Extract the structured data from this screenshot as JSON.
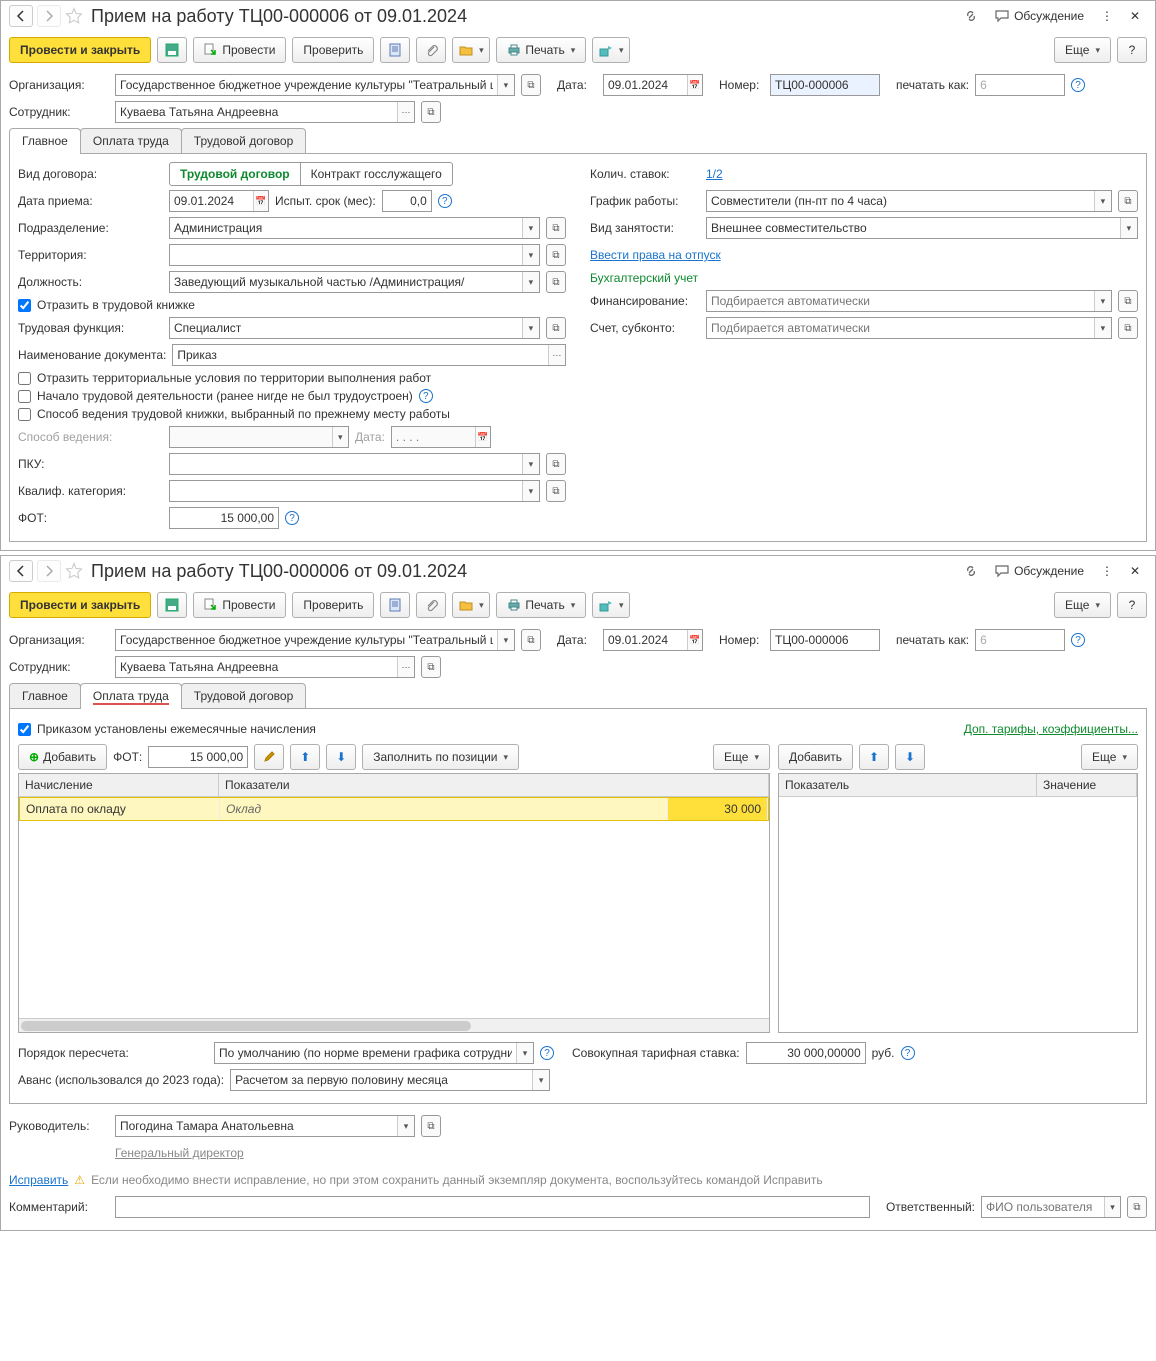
{
  "win1": {
    "title": "Прием на работу ТЦ00-000006 от 09.01.2024",
    "discuss": "Обсуждение",
    "toolbar": {
      "post_close": "Провести и закрыть",
      "post": "Провести",
      "check": "Проверить",
      "print": "Печать",
      "more": "Еще"
    },
    "org_lbl": "Организация:",
    "org_val": "Государственное бюджетное учреждение культуры \"Театральный центр\"",
    "date_lbl": "Дата:",
    "date_val": "09.01.2024",
    "num_lbl": "Номер:",
    "num_val": "ТЦ00-000006",
    "printas_lbl": "печатать как:",
    "printas_val": "6",
    "emp_lbl": "Сотрудник:",
    "emp_val": "Куваева Татьяна Андреевна",
    "tabs": [
      "Главное",
      "Оплата труда",
      "Трудовой договор"
    ],
    "main": {
      "contract_type_lbl": "Вид договора:",
      "seg_a": "Трудовой договор",
      "seg_b": "Контракт госслужащего",
      "hire_date_lbl": "Дата приема:",
      "hire_date_val": "09.01.2024",
      "probation_lbl": "Испыт. срок (мес):",
      "probation_val": "0,0",
      "dept_lbl": "Подразделение:",
      "dept_val": "Администрация",
      "territory_lbl": "Территория:",
      "territory_val": "",
      "position_lbl": "Должность:",
      "position_val": "Заведующий музыкальной частью /Администрация/",
      "reflect_lbl": "Отразить в трудовой книжке",
      "func_lbl": "Трудовая функция:",
      "func_val": "Специалист",
      "docname_lbl": "Наименование документа:",
      "docname_val": "Приказ",
      "chk2": "Отразить территориальные условия по территории выполнения работ",
      "chk3": "Начало трудовой деятельности (ранее нигде не был трудоустроен)",
      "chk4": "Способ ведения трудовой книжки, выбранный по прежнему месту работы",
      "method_lbl": "Способ ведения:",
      "method_date_lbl": "Дата:",
      "date_placeholder": ". . . .",
      "pku_lbl": "ПКУ:",
      "qual_lbl": "Квалиф. категория:",
      "fot_lbl": "ФОТ:",
      "fot_val": "15 000,00",
      "rates_lbl": "Колич. ставок:",
      "rates_val": "1/2",
      "schedule_lbl": "График работы:",
      "schedule_val": "Совместители (пн-пт по 4 часа)",
      "emptype_lbl": "Вид занятости:",
      "emptype_val": "Внешнее совместительство",
      "vacation_link": "Ввести права на отпуск",
      "acc_hdr": "Бухгалтерский учет",
      "fin_lbl": "Финансирование:",
      "auto_placeholder": "Подбирается автоматически",
      "account_lbl": "Счет, субконто:"
    }
  },
  "win2": {
    "title": "Прием на работу ТЦ00-000006 от 09.01.2024",
    "discuss": "Обсуждение",
    "toolbar": {
      "post_close": "Провести и закрыть",
      "post": "Провести",
      "check": "Проверить",
      "print": "Печать",
      "more": "Еще"
    },
    "org_lbl": "Организация:",
    "org_val": "Государственное бюджетное учреждение культуры \"Театральный центр\"",
    "date_lbl": "Дата:",
    "date_val": "09.01.2024",
    "num_lbl": "Номер:",
    "num_val": "ТЦ00-000006",
    "printas_lbl": "печатать как:",
    "printas_val": "6",
    "emp_lbl": "Сотрудник:",
    "emp_val": "Куваева Татьяна Андреевна",
    "tabs": [
      "Главное",
      "Оплата труда",
      "Трудовой договор"
    ],
    "pay": {
      "monthly_chk": "Приказом установлены ежемесячные начисления",
      "extra_link": "Доп. тарифы, коэффициенты...",
      "add": "Добавить",
      "fot_lbl": "ФОТ:",
      "fot_val": "15 000,00",
      "fill": "Заполнить по позиции",
      "more": "Еще",
      "add2": "Добавить",
      "th1": "Начисление",
      "th2": "Показатели",
      "th3": "Показатель",
      "th4": "Значение",
      "r1c1": "Оплата по окладу",
      "r1c2": "Оклад",
      "r1c3": "30 000",
      "recalc_lbl": "Порядок пересчета:",
      "recalc_val": "По умолчанию (по норме времени графика сотрудника)",
      "total_rate_lbl": "Совокупная тарифная ставка:",
      "total_rate_val": "30 000,00000",
      "total_rate_cur": "руб.",
      "advance_lbl": "Аванс (использовался до 2023 года):",
      "advance_val": "Расчетом за первую половину месяца"
    },
    "footer": {
      "mgr_lbl": "Руководитель:",
      "mgr_val": "Погодина Тамара Анатольевна",
      "mgr_sub": "Генеральный директор",
      "fix": "Исправить",
      "fix_note": "Если необходимо внести исправление, но при этом сохранить данный экземпляр документа, воспользуйтесь командой Исправить",
      "comment_lbl": "Комментарий:",
      "resp_lbl": "Ответственный:",
      "resp_placeholder": "ФИО пользователя"
    }
  }
}
